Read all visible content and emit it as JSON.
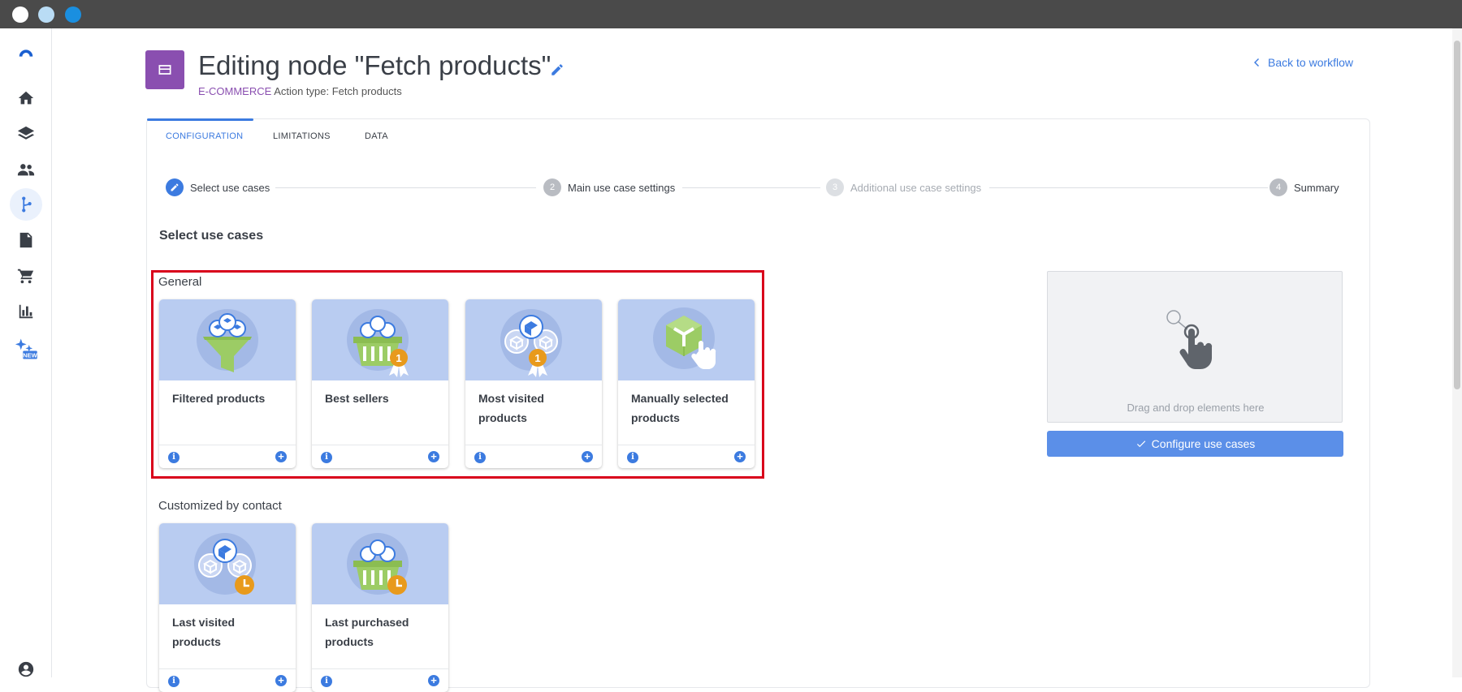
{
  "window": {
    "dots": [
      "#ffffff",
      "#b9dcf5",
      "#1a8fe0"
    ]
  },
  "sidebar": {
    "items": [
      {
        "name": "logo-icon"
      },
      {
        "name": "home-icon"
      },
      {
        "name": "layers-icon"
      },
      {
        "name": "people-icon"
      },
      {
        "name": "workflow-icon",
        "active": true
      },
      {
        "name": "document-icon"
      },
      {
        "name": "cart-icon"
      },
      {
        "name": "bar-chart-icon"
      },
      {
        "name": "ai-sparkle-icon",
        "badge": "NEW"
      },
      {
        "name": "account-icon"
      }
    ]
  },
  "header": {
    "title": "Editing node \"Fetch products\"",
    "category": "E-COMMERCE",
    "action_type": "Action type: Fetch products",
    "back_link": "Back to workflow"
  },
  "tabs": [
    {
      "label": "CONFIGURATION",
      "active": true
    },
    {
      "label": "LIMITATIONS",
      "active": false
    },
    {
      "label": "DATA",
      "active": false
    }
  ],
  "steps": [
    {
      "number": "1",
      "label": "Select use cases",
      "state": "active"
    },
    {
      "number": "2",
      "label": "Main use case settings",
      "state": "pending"
    },
    {
      "number": "3",
      "label": "Additional use case settings",
      "state": "disabled"
    },
    {
      "number": "4",
      "label": "Summary",
      "state": "pending"
    }
  ],
  "main": {
    "section_title": "Select use cases",
    "groups": [
      {
        "label": "General",
        "cards": [
          {
            "label": "Filtered products",
            "icon": "funnel-boxes-icon"
          },
          {
            "label": "Best sellers",
            "icon": "basket-medal-icon"
          },
          {
            "label": "Most visited products",
            "icon": "boxes-medal-icon"
          },
          {
            "label": "Manually selected products",
            "icon": "box-hand-icon"
          }
        ]
      },
      {
        "label": "Customized by contact",
        "cards": [
          {
            "label": "Last visited products",
            "icon": "boxes-clock-icon"
          },
          {
            "label": "Last purchased products",
            "icon": "basket-clock-icon"
          }
        ]
      }
    ],
    "card_actions": {
      "info": "i",
      "add": "+"
    }
  },
  "dropzone": {
    "text": "Drag and drop elements here",
    "button": "Configure use cases"
  },
  "colors": {
    "accent": "#3c7be0",
    "category": "#8a4fb0",
    "highlight": "#d9001b",
    "card_bg": "#b9ccf1"
  }
}
